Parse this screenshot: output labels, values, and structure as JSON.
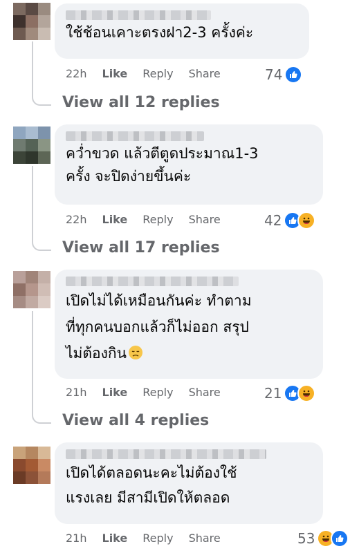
{
  "comments": [
    {
      "text": "ใช้ช้อนเคาะตรงฝา2-3 ครั้งค่ะ",
      "time": "22h",
      "like": "Like",
      "reply": "Reply",
      "share": "Share",
      "reaction_count": "74",
      "reactions": [
        "like"
      ],
      "replies_link": "View all 12 replies"
    },
    {
      "text": "คว่ำขวด แล้วตีตูดประมาณ1-3\nครั้ง จะปิดง่ายขึ้นค่ะ",
      "time": "22h",
      "like": "Like",
      "reply": "Reply",
      "share": "Share",
      "reaction_count": "42",
      "reactions": [
        "like",
        "haha"
      ],
      "replies_link": "View all 17 replies"
    },
    {
      "text": "เปิดไม่ได้เหมือนกันค่ะ ทำตาม\nที่ทุกคนบอกแล้วก็ไม่ออก สรุป\nไม่ต้องกิน",
      "inline_emoji": "disappointed-face",
      "time": "21h",
      "like": "Like",
      "reply": "Reply",
      "share": "Share",
      "reaction_count": "21",
      "reactions": [
        "like",
        "haha"
      ],
      "replies_link": "View all 4 replies"
    },
    {
      "text": "เปิดได้ตลอดนะคะไม่ต้องใช้\nแรงเลย มีสามีเปิดให้ตลอด",
      "time": "21h",
      "like": "Like",
      "reply": "Reply",
      "share": "Share",
      "reaction_count": "53",
      "reactions": [
        "haha",
        "like"
      ]
    }
  ],
  "colors": {
    "like_blue": "#1877f2",
    "haha_yellow": "#f7b125",
    "meta_gray": "#65676b",
    "bubble": "#f0f2f5"
  }
}
